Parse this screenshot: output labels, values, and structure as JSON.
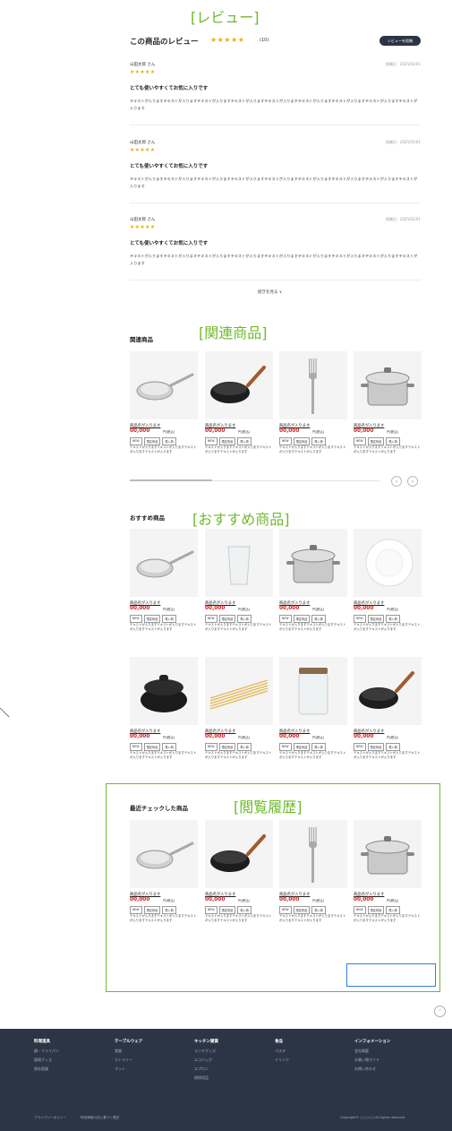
{
  "annotations": {
    "review": "[レビュー]",
    "related": "[関連商品]",
    "recommended": "[おすすめ商品]",
    "history": "[閲覧履歴]"
  },
  "review_section": {
    "title": "この商品のレビュー",
    "stars": "★★★★★",
    "count": "(10)",
    "write_button": "レビューを投稿",
    "reviews": [
      {
        "name": "山田太郎 さん",
        "date": "投稿日：2025/01/01",
        "stars": "★★★★★",
        "title": "とても使いやすくてお気に入りです",
        "body": "テキストが入りますテキストが入りますテキストが入りますテキストが入りますテキストが入りますテキストが入りますテキストが入りますテキストが入りますテキストが入ります"
      },
      {
        "name": "山田太郎 さん",
        "date": "投稿日：2025/01/01",
        "stars": "★★★★★",
        "title": "とても使いやすくてお気に入りです",
        "body": "テキストが入りますテキストが入りますテキストが入りますテキストが入りますテキストが入りますテキストが入りますテキストが入りますテキストが入りますテキストが入ります"
      },
      {
        "name": "山田太郎 さん",
        "date": "投稿日：2025/01/01",
        "stars": "★★★★★",
        "title": "とても使いやすくてお気に入りです",
        "body": "テキストが入りますテキストが入りますテキストが入りますテキストが入りますテキストが入りますテキストが入りますテキストが入りますテキストが入りますテキストが入ります"
      }
    ],
    "more_label": "続きを見る ∨"
  },
  "product_template": {
    "name": "商品名が入ります",
    "price": "00,000",
    "tax": "円(税込)",
    "tags": [
      "NEW",
      "限定商品",
      "再入荷"
    ],
    "desc": "テキストが入りますテキストが入りますテキストが入りますテキストが入ります"
  },
  "related": {
    "title": "関連商品",
    "items": [
      "frypan",
      "wok",
      "fork",
      "pot"
    ],
    "prev": "‹",
    "next": "›"
  },
  "recommended": {
    "title": "おすすめ商品",
    "items": [
      "frypan",
      "glass",
      "pot",
      "plate",
      "donabe",
      "pasta",
      "jar",
      "wok"
    ]
  },
  "recent": {
    "title": "最近チェックした商品",
    "items": [
      "frypan",
      "wok",
      "fork",
      "pot"
    ]
  },
  "page_top": "⌃",
  "footer": {
    "columns": [
      {
        "heading": "料理道具",
        "items": [
          "鍋・フライパン",
          "調理グッズ",
          "保存容器"
        ]
      },
      {
        "heading": "テーブルウェア",
        "items": [
          "食器",
          "カトラリー",
          "マット"
        ]
      },
      {
        "heading": "キッチン雑貨",
        "items": [
          "ランチグッズ",
          "エコバッグ",
          "エプロン",
          "掃除用品"
        ]
      },
      {
        "heading": "食品",
        "items": [
          "パスタ",
          "ドリンク"
        ]
      },
      {
        "heading": "インフォメーション",
        "items": [
          "会社概要",
          "お買い物ガイド",
          "お問い合わせ"
        ]
      }
    ],
    "social": [
      {
        "icon": "instagram-icon",
        "glyph": "◎"
      },
      {
        "icon": "x-icon",
        "glyph": "𝕏"
      },
      {
        "icon": "facebook-icon",
        "glyph": "f"
      },
      {
        "icon": "youtube-icon",
        "glyph": "▶"
      },
      {
        "icon": "line-icon",
        "glyph": "●"
      }
    ],
    "privacy": "プライバシーポリシー",
    "legal": "特定商取引法に基づく表記",
    "copyright": "Copyright© ○○○○○ All rights reserved."
  },
  "colors": {
    "accent_green": "#6fba2c",
    "accent_blue": "#2f7de8",
    "footer_bg": "#2b3545",
    "price_red": "#d21f1f",
    "star": "#e9b212"
  }
}
